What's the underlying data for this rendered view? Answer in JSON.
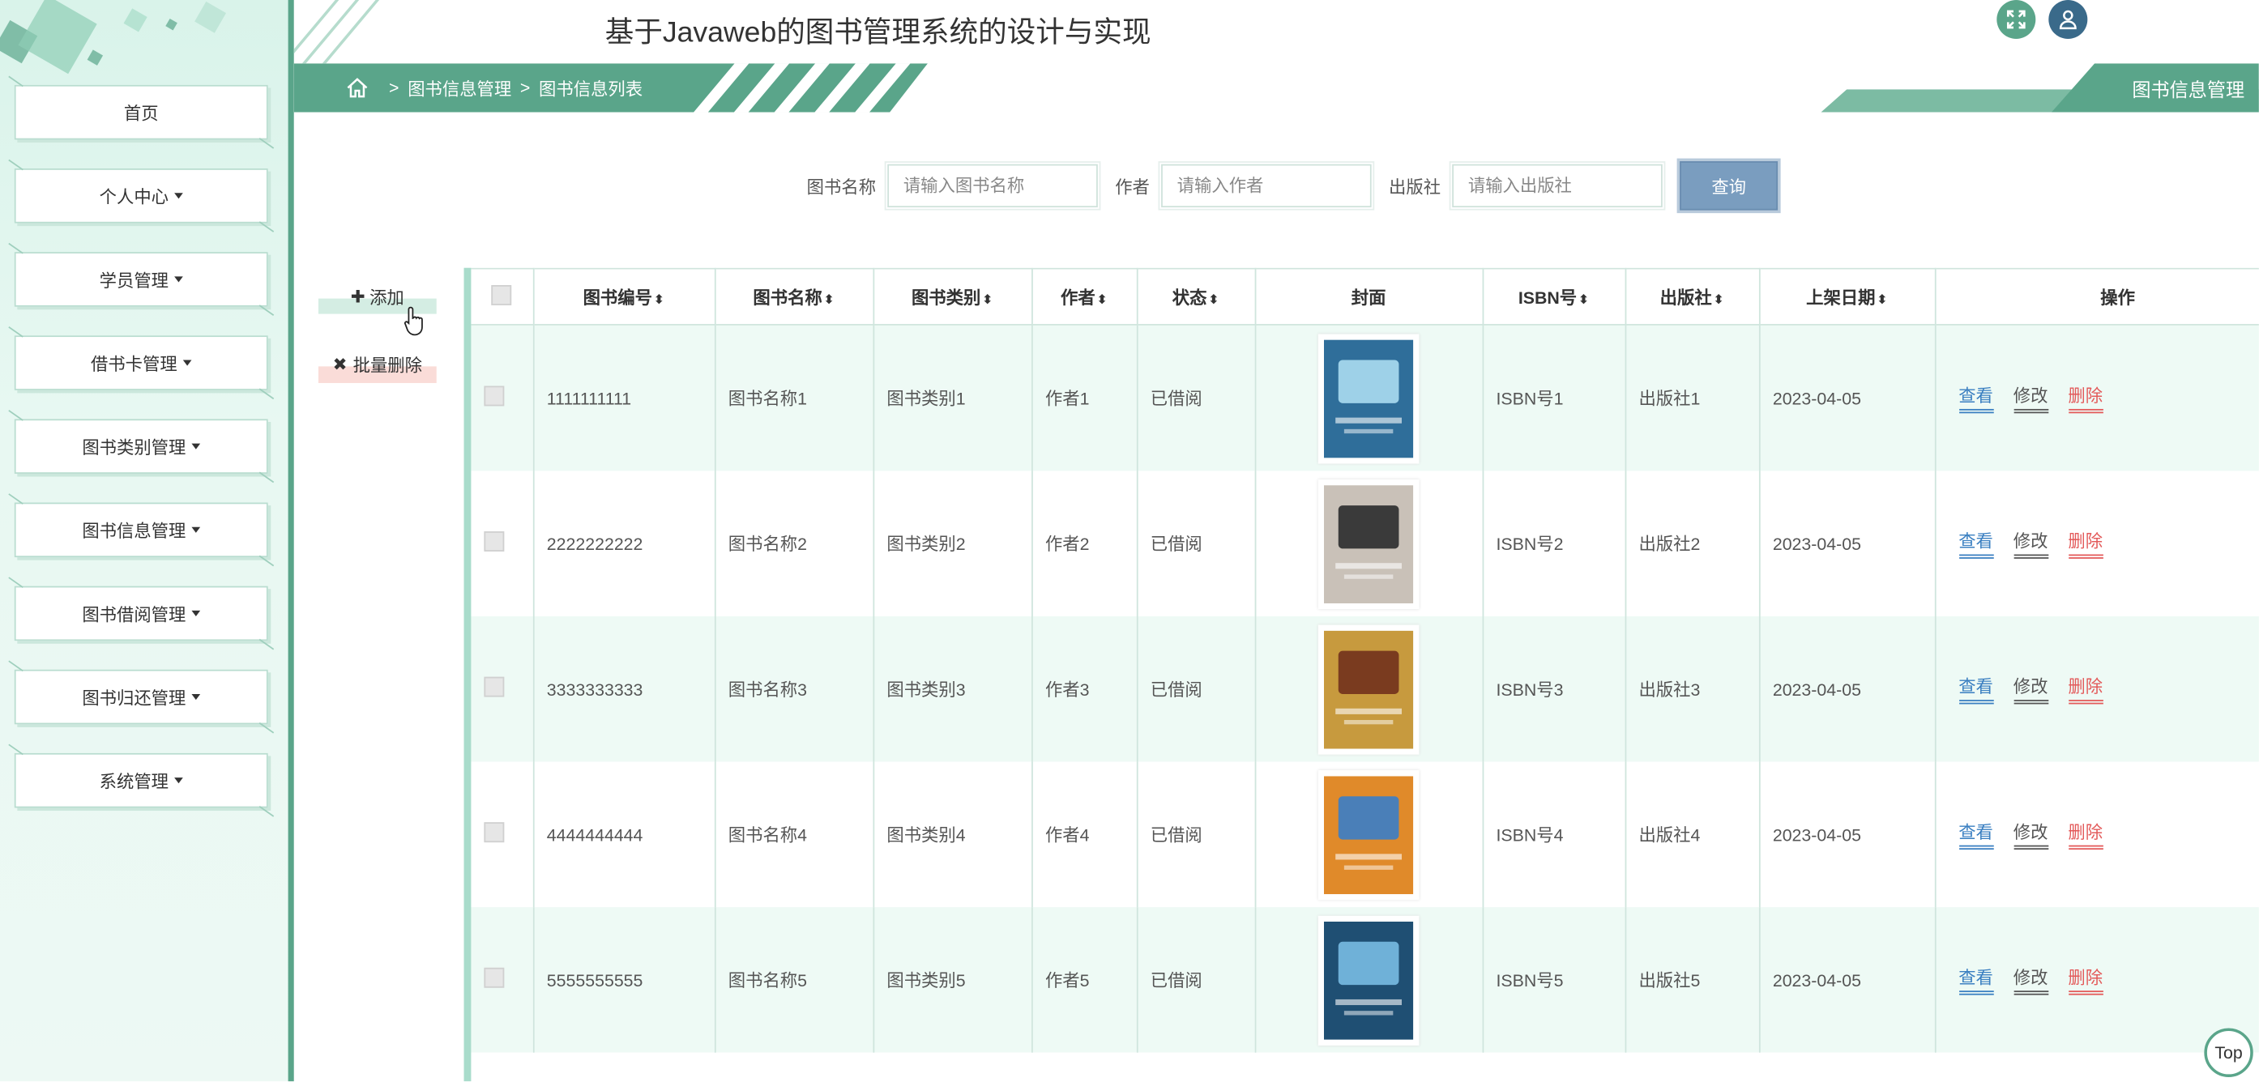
{
  "header": {
    "title": "基于Javaweb的图书管理系统的设计与实现"
  },
  "breadcrumb": {
    "items": [
      "图书信息管理",
      "图书信息列表"
    ],
    "separator": ">"
  },
  "right_tag": "图书信息管理",
  "sidebar": {
    "items": [
      {
        "label": "首页",
        "dropdown": false
      },
      {
        "label": "个人中心",
        "dropdown": true
      },
      {
        "label": "学员管理",
        "dropdown": true
      },
      {
        "label": "借书卡管理",
        "dropdown": true
      },
      {
        "label": "图书类别管理",
        "dropdown": true
      },
      {
        "label": "图书信息管理",
        "dropdown": true
      },
      {
        "label": "图书借阅管理",
        "dropdown": true
      },
      {
        "label": "图书归还管理",
        "dropdown": true
      },
      {
        "label": "系统管理",
        "dropdown": true
      }
    ]
  },
  "search": {
    "name_label": "图书名称",
    "name_placeholder": "请输入图书名称",
    "author_label": "作者",
    "author_placeholder": "请输入作者",
    "publisher_label": "出版社",
    "publisher_placeholder": "请输入出版社",
    "submit_label": "查询"
  },
  "actions": {
    "add_label": "添加",
    "batch_delete_label": "批量删除"
  },
  "table": {
    "columns": [
      "图书编号",
      "图书名称",
      "图书类别",
      "作者",
      "状态",
      "封面",
      "ISBN号",
      "出版社",
      "上架日期",
      "操作"
    ],
    "rows": [
      {
        "id": "1111111111",
        "name": "图书名称1",
        "category": "图书类别1",
        "author": "作者1",
        "status": "已借阅",
        "isbn": "ISBN号1",
        "publisher": "出版社1",
        "date": "2023-04-05"
      },
      {
        "id": "2222222222",
        "name": "图书名称2",
        "category": "图书类别2",
        "author": "作者2",
        "status": "已借阅",
        "isbn": "ISBN号2",
        "publisher": "出版社2",
        "date": "2023-04-05"
      },
      {
        "id": "3333333333",
        "name": "图书名称3",
        "category": "图书类别3",
        "author": "作者3",
        "status": "已借阅",
        "isbn": "ISBN号3",
        "publisher": "出版社3",
        "date": "2023-04-05"
      },
      {
        "id": "4444444444",
        "name": "图书名称4",
        "category": "图书类别4",
        "author": "作者4",
        "status": "已借阅",
        "isbn": "ISBN号4",
        "publisher": "出版社4",
        "date": "2023-04-05"
      },
      {
        "id": "5555555555",
        "name": "图书名称5",
        "category": "图书类别5",
        "author": "作者5",
        "status": "已借阅",
        "isbn": "ISBN号5",
        "publisher": "出版社5",
        "date": "2023-04-05"
      }
    ],
    "ops": {
      "view": "查看",
      "edit": "修改",
      "delete": "删除"
    }
  },
  "covers": [
    {
      "bg": "#2f6e9a",
      "accent": "#9ed1e8"
    },
    {
      "bg": "#c9c1b8",
      "accent": "#3a3a3a"
    },
    {
      "bg": "#c79a3e",
      "accent": "#7a3b1f"
    },
    {
      "bg": "#e08a2a",
      "accent": "#4a7fb8"
    },
    {
      "bg": "#1f4f73",
      "accent": "#6fb1d8"
    }
  ],
  "top_button": "Top",
  "colors": {
    "primary": "#5aa58a",
    "sidebar_bg": "#e3f6ee",
    "search_button": "#7a9dbf",
    "view_link": "#3a7fc1",
    "delete_link": "#e35a5a"
  }
}
